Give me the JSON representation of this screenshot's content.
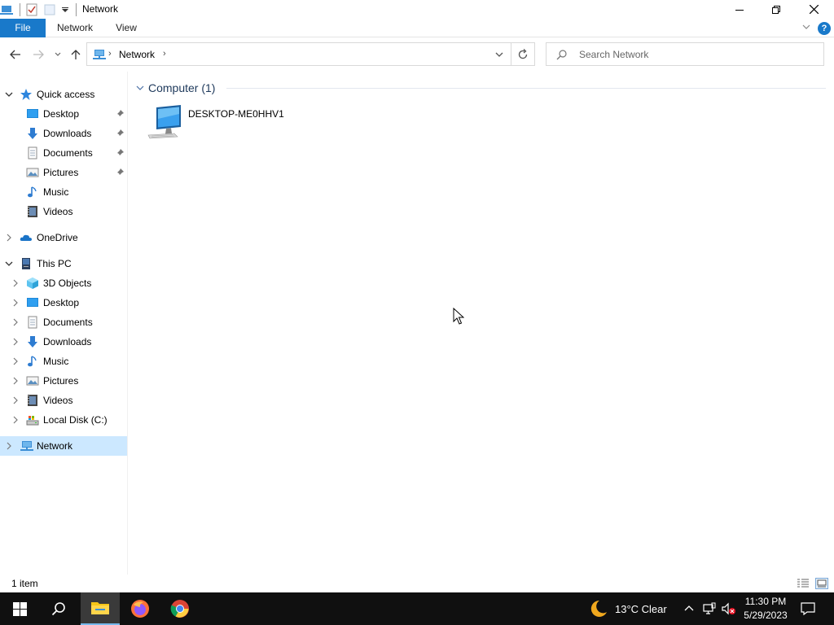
{
  "window": {
    "title": "Network",
    "minimize_glyph": "—",
    "restore_glyph": "❐",
    "close_glyph": "✕"
  },
  "ribbon": {
    "tabs": [
      "File",
      "Network",
      "View"
    ],
    "help_glyph": "?"
  },
  "address_bar": {
    "path": "Network",
    "chevron": "›"
  },
  "search": {
    "placeholder": "Search Network"
  },
  "nav_pane": {
    "quick_access": {
      "label": "Quick access",
      "items": [
        "Desktop",
        "Downloads",
        "Documents",
        "Pictures",
        "Music",
        "Videos"
      ]
    },
    "onedrive": {
      "label": "OneDrive"
    },
    "this_pc": {
      "label": "This PC",
      "items": [
        "3D Objects",
        "Desktop",
        "Documents",
        "Downloads",
        "Music",
        "Pictures",
        "Videos",
        "Local Disk (C:)"
      ]
    },
    "network": {
      "label": "Network",
      "selected": true
    }
  },
  "content": {
    "group_title": "Computer (1)",
    "items": [
      {
        "name": "DESKTOP-ME0HHV1",
        "icon": "computer-icon"
      }
    ]
  },
  "status_bar": {
    "item_count": "1 item"
  },
  "taskbar": {
    "weather": "13°C  Clear",
    "time": "11:30 PM",
    "date": "5/29/2023",
    "accent": "#76b9ed"
  },
  "colors": {
    "file_tab": "#1979ca",
    "selection": "#cce8ff",
    "group_title": "#1e395b"
  }
}
